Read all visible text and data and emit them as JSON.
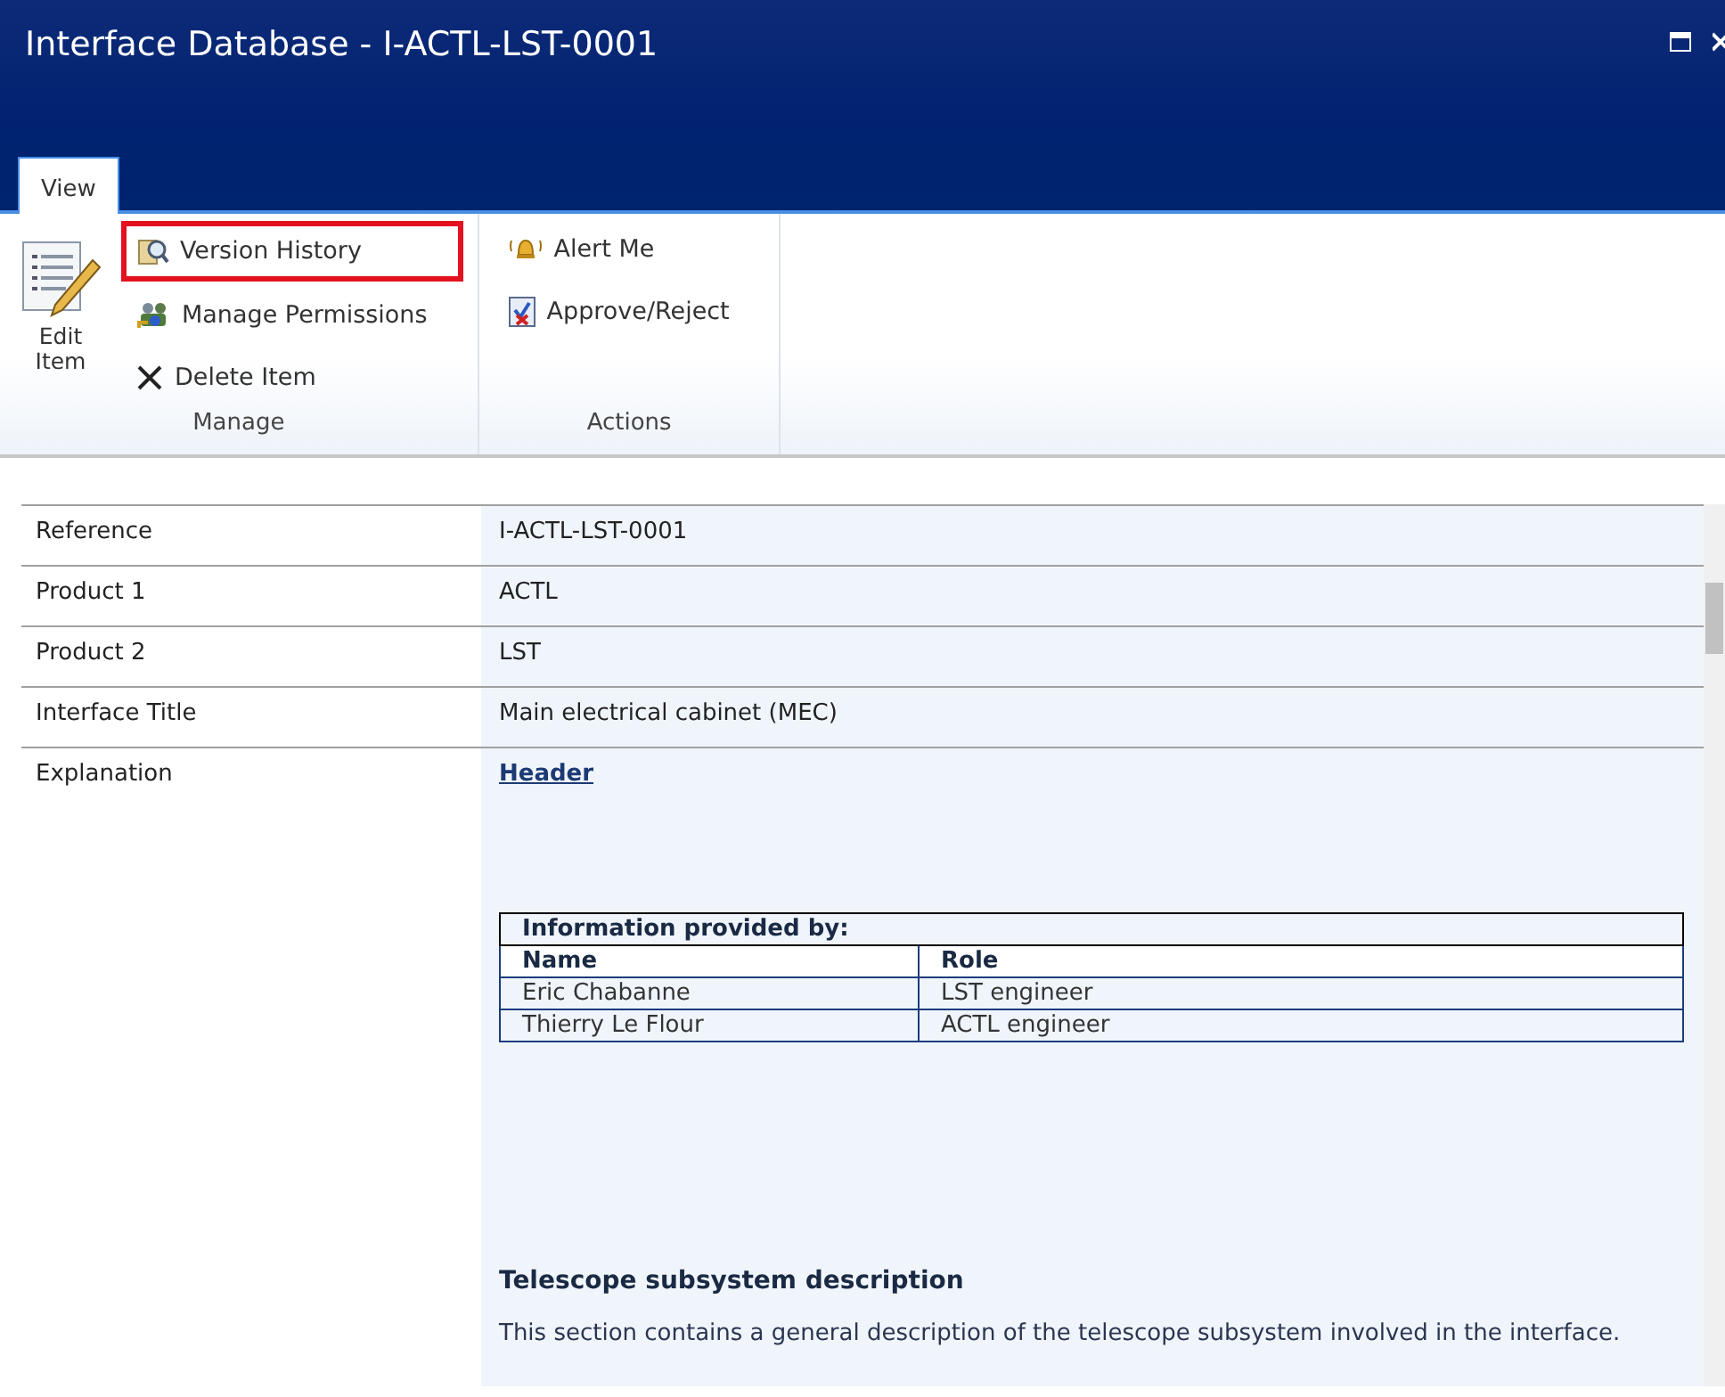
{
  "window": {
    "title": "Interface Database - I-ACTL-LST-0001"
  },
  "tabs": [
    {
      "label": "View",
      "selected": true
    }
  ],
  "ribbon": {
    "groups": [
      {
        "label": "Manage",
        "items": [
          {
            "label": "Edit Item",
            "kind": "large",
            "highlighted": false
          },
          {
            "label": "Version History",
            "kind": "small",
            "highlighted": true
          },
          {
            "label": "Manage Permissions",
            "kind": "small",
            "highlighted": false
          },
          {
            "label": "Delete Item",
            "kind": "small",
            "highlighted": false
          }
        ]
      },
      {
        "label": "Actions",
        "items": [
          {
            "label": "Alert Me",
            "kind": "small",
            "highlighted": false
          },
          {
            "label": "Approve/Reject",
            "kind": "small",
            "highlighted": false
          }
        ]
      }
    ]
  },
  "fields": [
    {
      "label": "Reference",
      "value": "I-ACTL-LST-0001"
    },
    {
      "label": "Product 1",
      "value": "ACTL"
    },
    {
      "label": "Product 2",
      "value": "LST"
    },
    {
      "label": "Interface Title",
      "value": "Main electrical cabinet (MEC)"
    }
  ],
  "explanation": {
    "label": "Explanation",
    "link": "Header",
    "table": {
      "caption": "Information provided by:",
      "columns": [
        "Name",
        "Role"
      ],
      "rows": [
        [
          "Eric Chabanne",
          "LST engineer"
        ],
        [
          "Thierry Le Flour",
          "ACTL engineer"
        ]
      ]
    },
    "heading": "Telescope subsystem description",
    "text": "This section contains a general description of the telescope subsystem involved in the interface."
  }
}
